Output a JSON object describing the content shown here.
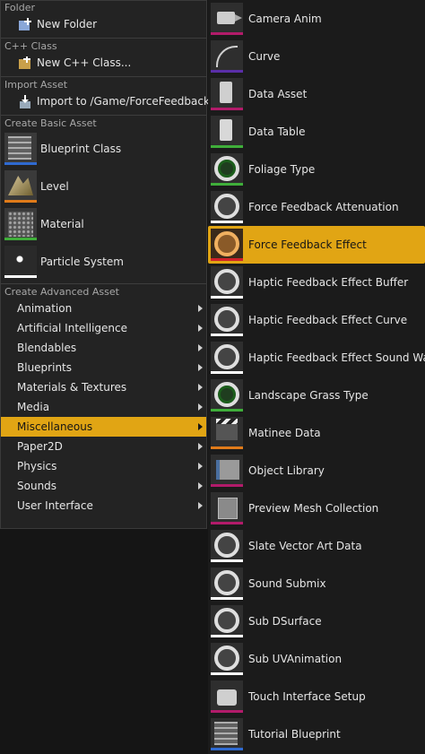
{
  "left": {
    "folder": {
      "section": "Folder",
      "item": "New Folder",
      "icon": "new-folder-icon"
    },
    "cpp": {
      "section": "C++ Class",
      "item": "New C++ Class...",
      "icon": "cpp-class-icon"
    },
    "import": {
      "section": "Import Asset",
      "item": "Import to /Game/ForceFeedback...",
      "icon": "import-icon"
    },
    "basic": {
      "section": "Create Basic Asset",
      "items": [
        {
          "label": "Blueprint Class",
          "icon": "blueprint-icon",
          "color": "#2f6ad1"
        },
        {
          "label": "Level",
          "icon": "level-icon",
          "color": "#e07b1a"
        },
        {
          "label": "Material",
          "icon": "material-icon",
          "color": "#3fae3a"
        },
        {
          "label": "Particle System",
          "icon": "particle-icon",
          "color": "#ffffff"
        }
      ]
    },
    "advanced": {
      "section": "Create Advanced Asset",
      "items": [
        "Animation",
        "Artificial Intelligence",
        "Blendables",
        "Blueprints",
        "Materials & Textures",
        "Media",
        "Miscellaneous",
        "Paper2D",
        "Physics",
        "Sounds",
        "User Interface"
      ],
      "selected": "Miscellaneous"
    }
  },
  "right": {
    "selected": "Force Feedback Effect",
    "accent": "#e1a514",
    "items": [
      {
        "label": "Camera Anim",
        "icon": "camera-icon",
        "color": "#b21b6a"
      },
      {
        "label": "Curve",
        "icon": "curve-icon",
        "color": "#5a2ea8"
      },
      {
        "label": "Data Asset",
        "icon": "data-asset-icon",
        "color": "#b21b6a"
      },
      {
        "label": "Data Table",
        "icon": "data-table-icon",
        "color": "#3fae3a"
      },
      {
        "label": "Foliage Type",
        "icon": "foliage-icon",
        "color": "#3fae3a"
      },
      {
        "label": "Force Feedback Attenuation",
        "icon": "ring-icon",
        "color": "#ffffff"
      },
      {
        "label": "Force Feedback Effect",
        "icon": "force-feedback-icon",
        "color": "#d0212a"
      },
      {
        "label": "Haptic Feedback Effect Buffer",
        "icon": "ring-icon",
        "color": "#ffffff"
      },
      {
        "label": "Haptic Feedback Effect Curve",
        "icon": "ring-icon",
        "color": "#ffffff"
      },
      {
        "label": "Haptic Feedback Effect Sound Wave",
        "icon": "ring-icon",
        "color": "#ffffff"
      },
      {
        "label": "Landscape Grass Type",
        "icon": "grass-icon",
        "color": "#3fae3a"
      },
      {
        "label": "Matinee Data",
        "icon": "clapperboard-icon",
        "color": "#e07b1a"
      },
      {
        "label": "Object Library",
        "icon": "object-library-icon",
        "color": "#b21b6a"
      },
      {
        "label": "Preview Mesh Collection",
        "icon": "preview-mesh-icon",
        "color": "#b21b6a"
      },
      {
        "label": "Slate Vector Art Data",
        "icon": "ring-icon",
        "color": "#ffffff"
      },
      {
        "label": "Sound Submix",
        "icon": "ring-icon",
        "color": "#ffffff"
      },
      {
        "label": "Sub DSurface",
        "icon": "ring-icon",
        "color": "#ffffff"
      },
      {
        "label": "Sub UVAnimation",
        "icon": "ring-icon",
        "color": "#ffffff"
      },
      {
        "label": "Touch Interface Setup",
        "icon": "touch-interface-icon",
        "color": "#b21b6a"
      },
      {
        "label": "Tutorial Blueprint",
        "icon": "blueprint-icon",
        "color": "#2f6ad1"
      }
    ]
  }
}
